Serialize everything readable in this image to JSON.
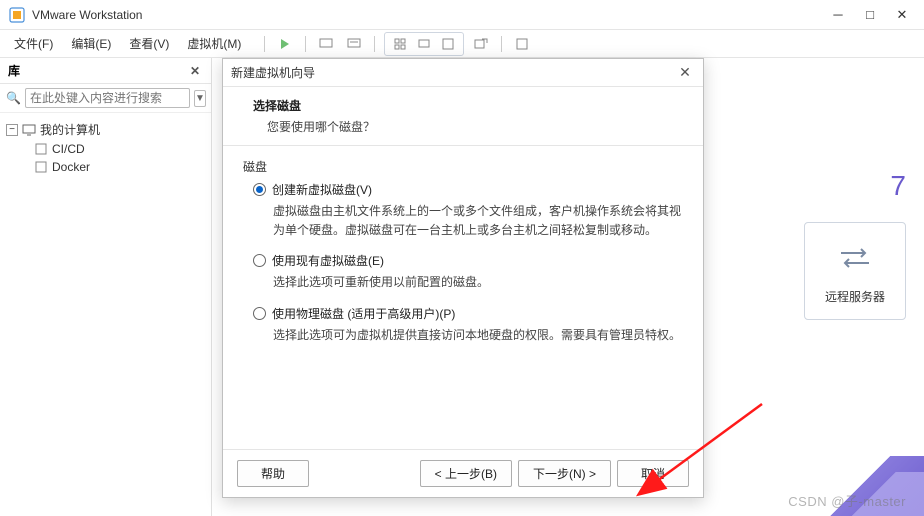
{
  "app": {
    "title": "VMware Workstation"
  },
  "menu": {
    "items": [
      "文件(F)",
      "编辑(E)",
      "查看(V)",
      "虚拟机(M)"
    ]
  },
  "sidebar": {
    "title": "库",
    "search_placeholder": "在此处键入内容进行搜索",
    "root": "我的计算机",
    "children": [
      "CI/CD",
      "Docker"
    ]
  },
  "dialog": {
    "title": "新建虚拟机向导",
    "heading": "选择磁盘",
    "subtext": "您要使用哪个磁盘？",
    "group_label": "磁盘",
    "options": [
      {
        "label": "创建新虚拟磁盘(V)",
        "desc": "虚拟磁盘由主机文件系统上的一个或多个文件组成，客户机操作系统会将其视为单个硬盘。虚拟磁盘可在一台主机上或多台主机之间轻松复制或移动。",
        "checked": true
      },
      {
        "label": "使用现有虚拟磁盘(E)",
        "desc": "选择此选项可重新使用以前配置的磁盘。",
        "checked": false
      },
      {
        "label": "使用物理磁盘 (适用于高级用户)(P)",
        "desc": "选择此选项可为虚拟机提供直接访问本地硬盘的权限。需要具有管理员特权。",
        "checked": false
      }
    ],
    "buttons": {
      "help": "帮助",
      "back": "< 上一步(B)",
      "next": "下一步(N) >",
      "cancel": "取消"
    }
  },
  "right": {
    "version_digit": "7",
    "connect_label": "远程服务器"
  },
  "watermark": "CSDN @子-master"
}
